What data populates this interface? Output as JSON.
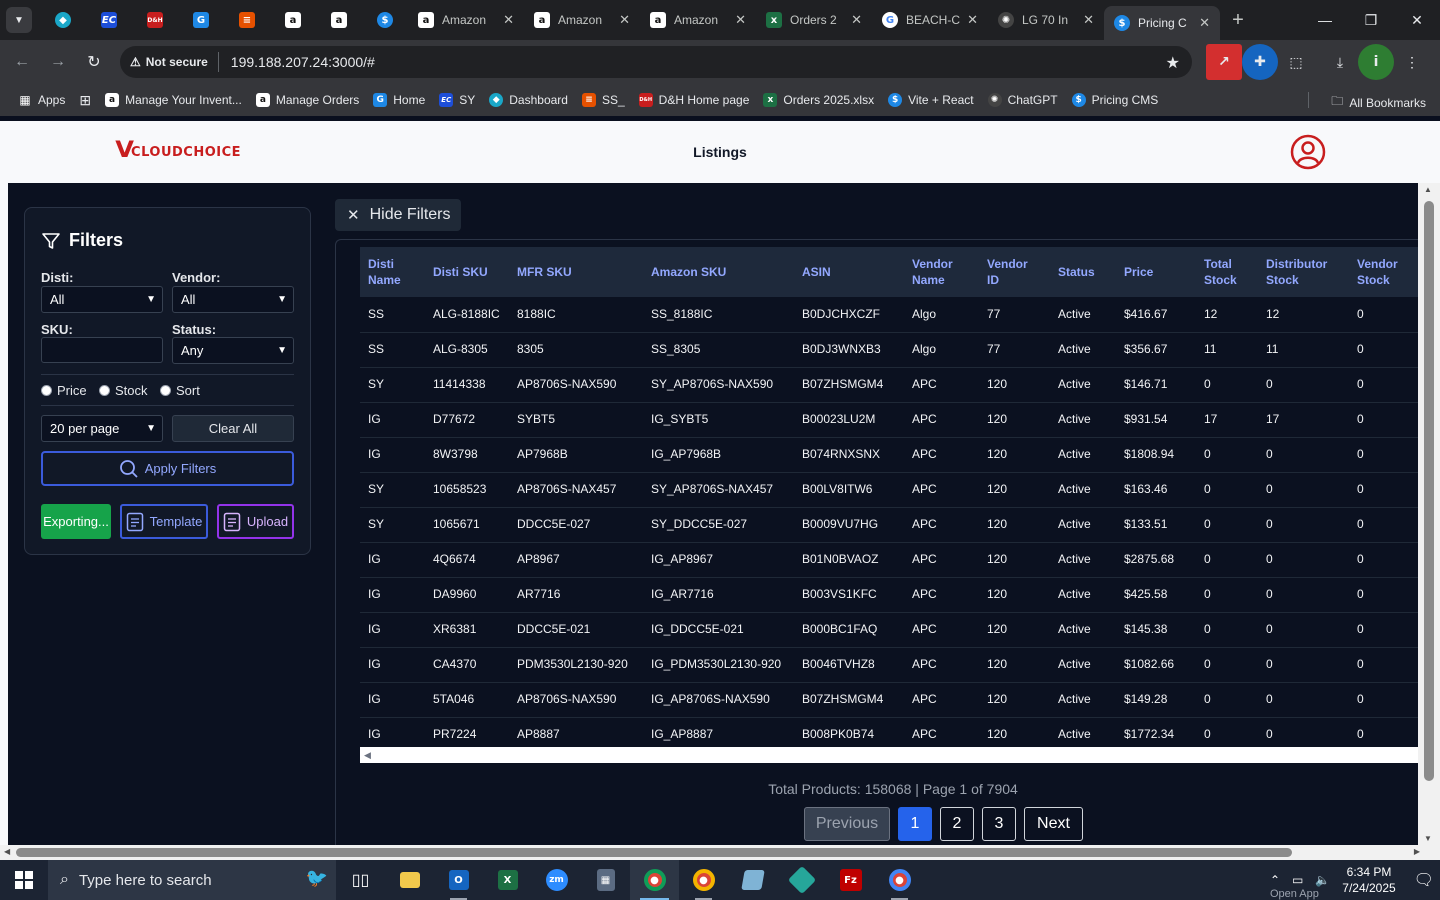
{
  "browser": {
    "tabs": [
      {
        "title": "Amazon",
        "favicon": "amazon-icon"
      },
      {
        "title": "Amazon",
        "favicon": "amazon-icon"
      },
      {
        "title": "Amazon",
        "favicon": "amazon-icon"
      },
      {
        "title": "Orders 2",
        "favicon": "excel-icon"
      },
      {
        "title": "BEACH-C",
        "favicon": "google-icon"
      },
      {
        "title": "LG 70 In",
        "favicon": "chatgpt-icon"
      },
      {
        "title": "Pricing C",
        "favicon": "dollar-icon",
        "active": true
      }
    ],
    "security_label": "Not secure",
    "url": "199.188.207.24:3000/#",
    "bookmarks": [
      {
        "label": "Apps",
        "icon": "apps-grid-icon"
      },
      {
        "label": "Manage Your Invent...",
        "icon": "amazon-icon"
      },
      {
        "label": "Manage Orders",
        "icon": "amazon-icon"
      },
      {
        "label": "Home",
        "icon": "home-app-icon"
      },
      {
        "label": "SY",
        "icon": "ec-icon"
      },
      {
        "label": "Dashboard",
        "icon": "dashboard-app-icon"
      },
      {
        "label": "SS_",
        "icon": "ss-app-icon"
      },
      {
        "label": "D&H Home page",
        "icon": "dh-icon"
      },
      {
        "label": "Orders 2025.xlsx",
        "icon": "excel-icon"
      },
      {
        "label": "Vite + React",
        "icon": "dollar-icon"
      },
      {
        "label": "ChatGPT",
        "icon": "chatgpt-icon"
      },
      {
        "label": "Pricing CMS",
        "icon": "dollar-icon"
      }
    ],
    "all_bookmarks": "All Bookmarks"
  },
  "app": {
    "logo_v": "V",
    "logo_cloud": "CLOUD",
    "logo_choice": "CHOICE",
    "page_title": "Listings"
  },
  "filters": {
    "title": "Filters",
    "disti_label": "Disti:",
    "disti_value": "All",
    "vendor_label": "Vendor:",
    "vendor_value": "All",
    "sku_label": "SKU:",
    "sku_value": "",
    "status_label": "Status:",
    "status_value": "Any",
    "sort_options": [
      "Price",
      "Stock",
      "Sort"
    ],
    "per_page": "20 per page",
    "clear_all": "Clear All",
    "apply": "Apply Filters",
    "exporting": "Exporting...",
    "template": "Template",
    "upload": "Upload"
  },
  "hide_filters": "Hide Filters",
  "table": {
    "columns": [
      "Disti Name",
      "Disti SKU",
      "MFR SKU",
      "Amazon SKU",
      "ASIN",
      "Vendor Name",
      "Vendor ID",
      "Status",
      "Price",
      "Total Stock",
      "Distributor Stock",
      "Vendor Stock"
    ],
    "rows": [
      [
        "SS",
        "ALG-8188IC",
        "8188IC",
        "SS_8188IC",
        "B0DJCHXCZF",
        "Algo",
        "77",
        "Active",
        "$416.67",
        "12",
        "12",
        "0"
      ],
      [
        "SS",
        "ALG-8305",
        "8305",
        "SS_8305",
        "B0DJ3WNXB3",
        "Algo",
        "77",
        "Active",
        "$356.67",
        "11",
        "11",
        "0"
      ],
      [
        "SY",
        "11414338",
        "AP8706S-NAX590",
        "SY_AP8706S-NAX590",
        "B07ZHSMGM4",
        "APC",
        "120",
        "Active",
        "$146.71",
        "0",
        "0",
        "0"
      ],
      [
        "IG",
        "D77672",
        "SYBT5",
        "IG_SYBT5",
        "B00023LU2M",
        "APC",
        "120",
        "Active",
        "$931.54",
        "17",
        "17",
        "0"
      ],
      [
        "IG",
        "8W3798",
        "AP7968B",
        "IG_AP7968B",
        "B074RNXSNX",
        "APC",
        "120",
        "Active",
        "$1808.94",
        "0",
        "0",
        "0"
      ],
      [
        "SY",
        "10658523",
        "AP8706S-NAX457",
        "SY_AP8706S-NAX457",
        "B00LV8ITW6",
        "APC",
        "120",
        "Active",
        "$163.46",
        "0",
        "0",
        "0"
      ],
      [
        "SY",
        "1065671",
        "DDCC5E-027",
        "SY_DDCC5E-027",
        "B0009VU7HG",
        "APC",
        "120",
        "Active",
        "$133.51",
        "0",
        "0",
        "0"
      ],
      [
        "IG",
        "4Q6674",
        "AP8967",
        "IG_AP8967",
        "B01N0BVAOZ",
        "APC",
        "120",
        "Active",
        "$2875.68",
        "0",
        "0",
        "0"
      ],
      [
        "IG",
        "DA9960",
        "AR7716",
        "IG_AR7716",
        "B003VS1KFC",
        "APC",
        "120",
        "Active",
        "$425.58",
        "0",
        "0",
        "0"
      ],
      [
        "IG",
        "XR6381",
        "DDCC5E-021",
        "IG_DDCC5E-021",
        "B000BC1FAQ",
        "APC",
        "120",
        "Active",
        "$145.38",
        "0",
        "0",
        "0"
      ],
      [
        "IG",
        "CA4370",
        "PDM3530L2130-920",
        "IG_PDM3530L2130-920",
        "B0046TVHZ8",
        "APC",
        "120",
        "Active",
        "$1082.66",
        "0",
        "0",
        "0"
      ],
      [
        "IG",
        "5TA046",
        "AP8706S-NAX590",
        "IG_AP8706S-NAX590",
        "B07ZHSMGM4",
        "APC",
        "120",
        "Active",
        "$149.28",
        "0",
        "0",
        "0"
      ],
      [
        "IG",
        "PR7224",
        "AP8887",
        "IG_AP8887",
        "B008PK0B74",
        "APC",
        "120",
        "Active",
        "$1772.34",
        "0",
        "0",
        "0"
      ]
    ]
  },
  "pagination": {
    "summary": "Total Products: 158068 | Page 1 of 7904",
    "previous": "Previous",
    "pages": [
      "1",
      "2",
      "3"
    ],
    "current": "1",
    "next": "Next"
  },
  "taskbar": {
    "search_placeholder": "Type here to search",
    "time": "6:34 PM",
    "date": "7/24/2025",
    "open_app": "Open App"
  },
  "colors": {
    "accent": "#3b5bdb",
    "export_green": "#16a34a",
    "upload_purple": "#9333ea",
    "logo_red": "#c81e1e"
  }
}
